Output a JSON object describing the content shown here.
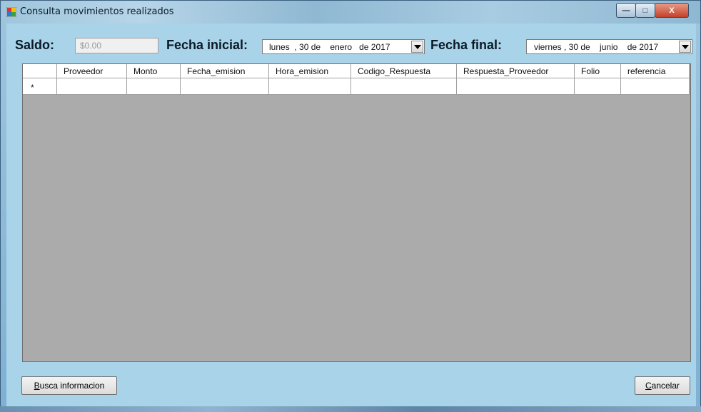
{
  "window": {
    "title": "Consulta movimientos realizados",
    "min_glyph": "—",
    "max_glyph": "□",
    "close_glyph": "X"
  },
  "form": {
    "saldo_label": "Saldo:",
    "saldo_value": "$0.00",
    "fecha_inicial_label": "Fecha inicial:",
    "fecha_inicial_value": "lunes  , 30 de    enero   de 2017",
    "fecha_final_label": "Fecha final:",
    "fecha_final_value": "viernes , 30 de    junio    de 2017"
  },
  "grid": {
    "columns": [
      "Proveedor",
      "Monto",
      "Fecha_emision",
      "Hora_emision",
      "Codigo_Respuesta",
      "Respuesta_Proveedor",
      "Folio",
      "referencia"
    ],
    "new_row_marker": "*"
  },
  "buttons": {
    "busca_label_rest": "usca informacion",
    "busca_mnemonic": "B",
    "cancelar_label_rest": "ancelar",
    "cancelar_mnemonic": "C"
  },
  "colors": {
    "form_bg": "#a8d3e8",
    "grid_bg": "#ababab"
  }
}
